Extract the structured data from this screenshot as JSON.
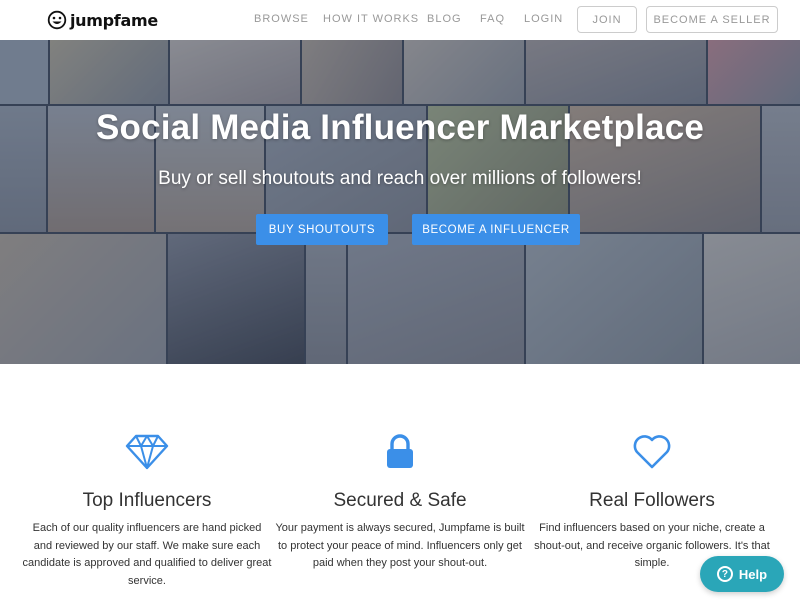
{
  "brand": {
    "name": "jumpfame",
    "logo_icon": "smiley-face-icon"
  },
  "nav": {
    "links": [
      "BROWSE",
      "HOW IT WORKS",
      "BLOG",
      "FAQ",
      "LOGIN"
    ],
    "join_label": "JOIN",
    "seller_label": "BECOME A SELLER"
  },
  "hero": {
    "title": "Social Media Influencer Marketplace",
    "subtitle": "Buy or sell shoutouts and reach over millions of followers!",
    "buy_label": "BUY SHOUTOUTS",
    "influencer_label": "BECOME A INFLUENCER"
  },
  "features": [
    {
      "icon": "diamond-icon",
      "title": "Top Influencers",
      "text": "Each of our quality influencers are hand picked and reviewed by our staff. We make sure each candidate is approved and qualified to deliver great service."
    },
    {
      "icon": "lock-icon",
      "title": "Secured & Safe",
      "text": "Your payment is always secured, Jumpfame is built to protect your peace of mind. Influencers only get paid when they post your shout-out."
    },
    {
      "icon": "heart-icon",
      "title": "Real Followers",
      "text": "Find influencers based on your niche, create a shout-out, and receive organic followers. It's that simple."
    }
  ],
  "help": {
    "label": "Help",
    "icon": "question-circle-icon"
  },
  "colors": {
    "accent": "#3b8fe8",
    "help": "#2aa6b8"
  }
}
